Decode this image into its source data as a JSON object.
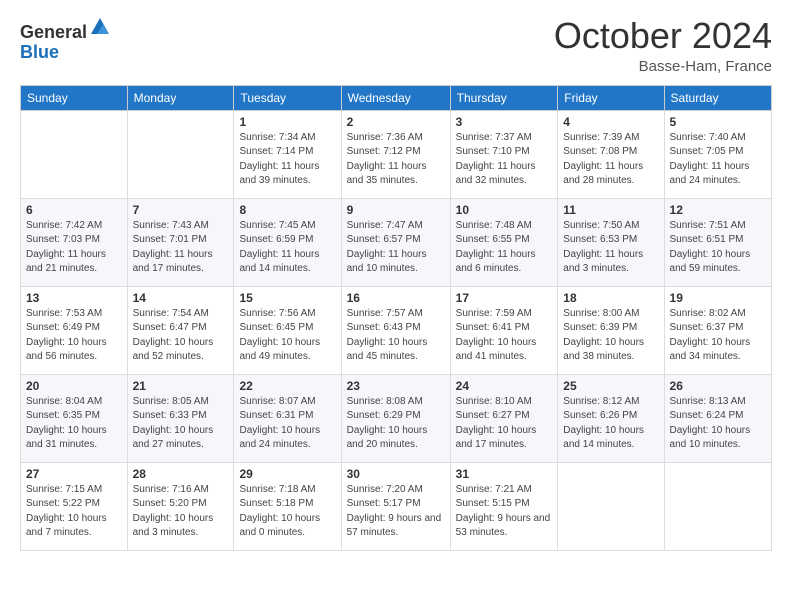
{
  "logo": {
    "general": "General",
    "blue": "Blue"
  },
  "header": {
    "month": "October 2024",
    "location": "Basse-Ham, France"
  },
  "weekdays": [
    "Sunday",
    "Monday",
    "Tuesday",
    "Wednesday",
    "Thursday",
    "Friday",
    "Saturday"
  ],
  "weeks": [
    [
      {
        "day": "",
        "info": ""
      },
      {
        "day": "",
        "info": ""
      },
      {
        "day": "1",
        "info": "Sunrise: 7:34 AM\nSunset: 7:14 PM\nDaylight: 11 hours and 39 minutes."
      },
      {
        "day": "2",
        "info": "Sunrise: 7:36 AM\nSunset: 7:12 PM\nDaylight: 11 hours and 35 minutes."
      },
      {
        "day": "3",
        "info": "Sunrise: 7:37 AM\nSunset: 7:10 PM\nDaylight: 11 hours and 32 minutes."
      },
      {
        "day": "4",
        "info": "Sunrise: 7:39 AM\nSunset: 7:08 PM\nDaylight: 11 hours and 28 minutes."
      },
      {
        "day": "5",
        "info": "Sunrise: 7:40 AM\nSunset: 7:05 PM\nDaylight: 11 hours and 24 minutes."
      }
    ],
    [
      {
        "day": "6",
        "info": "Sunrise: 7:42 AM\nSunset: 7:03 PM\nDaylight: 11 hours and 21 minutes."
      },
      {
        "day": "7",
        "info": "Sunrise: 7:43 AM\nSunset: 7:01 PM\nDaylight: 11 hours and 17 minutes."
      },
      {
        "day": "8",
        "info": "Sunrise: 7:45 AM\nSunset: 6:59 PM\nDaylight: 11 hours and 14 minutes."
      },
      {
        "day": "9",
        "info": "Sunrise: 7:47 AM\nSunset: 6:57 PM\nDaylight: 11 hours and 10 minutes."
      },
      {
        "day": "10",
        "info": "Sunrise: 7:48 AM\nSunset: 6:55 PM\nDaylight: 11 hours and 6 minutes."
      },
      {
        "day": "11",
        "info": "Sunrise: 7:50 AM\nSunset: 6:53 PM\nDaylight: 11 hours and 3 minutes."
      },
      {
        "day": "12",
        "info": "Sunrise: 7:51 AM\nSunset: 6:51 PM\nDaylight: 10 hours and 59 minutes."
      }
    ],
    [
      {
        "day": "13",
        "info": "Sunrise: 7:53 AM\nSunset: 6:49 PM\nDaylight: 10 hours and 56 minutes."
      },
      {
        "day": "14",
        "info": "Sunrise: 7:54 AM\nSunset: 6:47 PM\nDaylight: 10 hours and 52 minutes."
      },
      {
        "day": "15",
        "info": "Sunrise: 7:56 AM\nSunset: 6:45 PM\nDaylight: 10 hours and 49 minutes."
      },
      {
        "day": "16",
        "info": "Sunrise: 7:57 AM\nSunset: 6:43 PM\nDaylight: 10 hours and 45 minutes."
      },
      {
        "day": "17",
        "info": "Sunrise: 7:59 AM\nSunset: 6:41 PM\nDaylight: 10 hours and 41 minutes."
      },
      {
        "day": "18",
        "info": "Sunrise: 8:00 AM\nSunset: 6:39 PM\nDaylight: 10 hours and 38 minutes."
      },
      {
        "day": "19",
        "info": "Sunrise: 8:02 AM\nSunset: 6:37 PM\nDaylight: 10 hours and 34 minutes."
      }
    ],
    [
      {
        "day": "20",
        "info": "Sunrise: 8:04 AM\nSunset: 6:35 PM\nDaylight: 10 hours and 31 minutes."
      },
      {
        "day": "21",
        "info": "Sunrise: 8:05 AM\nSunset: 6:33 PM\nDaylight: 10 hours and 27 minutes."
      },
      {
        "day": "22",
        "info": "Sunrise: 8:07 AM\nSunset: 6:31 PM\nDaylight: 10 hours and 24 minutes."
      },
      {
        "day": "23",
        "info": "Sunrise: 8:08 AM\nSunset: 6:29 PM\nDaylight: 10 hours and 20 minutes."
      },
      {
        "day": "24",
        "info": "Sunrise: 8:10 AM\nSunset: 6:27 PM\nDaylight: 10 hours and 17 minutes."
      },
      {
        "day": "25",
        "info": "Sunrise: 8:12 AM\nSunset: 6:26 PM\nDaylight: 10 hours and 14 minutes."
      },
      {
        "day": "26",
        "info": "Sunrise: 8:13 AM\nSunset: 6:24 PM\nDaylight: 10 hours and 10 minutes."
      }
    ],
    [
      {
        "day": "27",
        "info": "Sunrise: 7:15 AM\nSunset: 5:22 PM\nDaylight: 10 hours and 7 minutes."
      },
      {
        "day": "28",
        "info": "Sunrise: 7:16 AM\nSunset: 5:20 PM\nDaylight: 10 hours and 3 minutes."
      },
      {
        "day": "29",
        "info": "Sunrise: 7:18 AM\nSunset: 5:18 PM\nDaylight: 10 hours and 0 minutes."
      },
      {
        "day": "30",
        "info": "Sunrise: 7:20 AM\nSunset: 5:17 PM\nDaylight: 9 hours and 57 minutes."
      },
      {
        "day": "31",
        "info": "Sunrise: 7:21 AM\nSunset: 5:15 PM\nDaylight: 9 hours and 53 minutes."
      },
      {
        "day": "",
        "info": ""
      },
      {
        "day": "",
        "info": ""
      }
    ]
  ]
}
